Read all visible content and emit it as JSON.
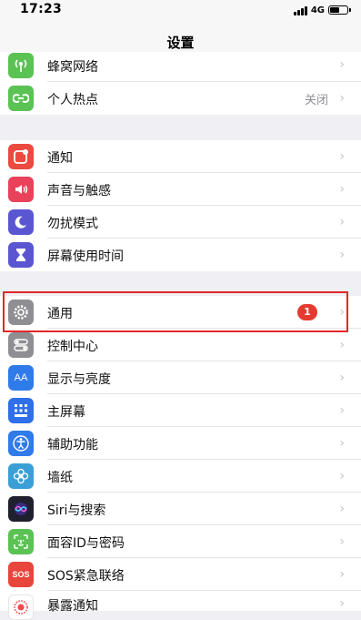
{
  "status_bar": {
    "time": "17:23",
    "network": "4G"
  },
  "nav": {
    "title": "设置"
  },
  "rows": [
    {
      "label": "蜂窝网络",
      "icon": "antenna-icon",
      "color": "#5bc254"
    },
    {
      "label": "个人热点",
      "icon": "hotspot-link-icon",
      "color": "#5bc254",
      "value": "关闭"
    },
    {
      "label": "通知",
      "icon": "notifications-icon",
      "color": "#ec4a40"
    },
    {
      "label": "声音与触感",
      "icon": "speaker-icon",
      "color": "#e9425a"
    },
    {
      "label": "勿扰模式",
      "icon": "moon-icon",
      "color": "#5a56d1"
    },
    {
      "label": "屏幕使用时间",
      "icon": "hourglass-icon",
      "color": "#5a56d1"
    },
    {
      "label": "通用",
      "icon": "gear-icon",
      "color": "#8e8e93",
      "badge": "1"
    },
    {
      "label": "控制中心",
      "icon": "toggles-icon",
      "color": "#8e8e93"
    },
    {
      "label": "显示与亮度",
      "icon": "text-size-icon",
      "color": "#2f7bea",
      "icon_text": "AA"
    },
    {
      "label": "主屏幕",
      "icon": "home-grid-icon",
      "color": "#2f6fe8"
    },
    {
      "label": "辅助功能",
      "icon": "accessibility-icon",
      "color": "#2f7bea"
    },
    {
      "label": "墙纸",
      "icon": "flower-icon",
      "color": "#3a9fd6"
    },
    {
      "label": "Siri与搜索",
      "icon": "siri-icon",
      "color": "#1f1f2e"
    },
    {
      "label": "面容ID与密码",
      "icon": "face-id-icon",
      "color": "#5bc254"
    },
    {
      "label": "SOS紧急联络",
      "icon": "sos-icon",
      "color": "#e8453c",
      "icon_text": "SOS"
    },
    {
      "label": "暴露通知",
      "icon": "exposure-icon",
      "color": "#ffffff"
    }
  ],
  "chevron": "›",
  "highlight_color": "#e0282c"
}
